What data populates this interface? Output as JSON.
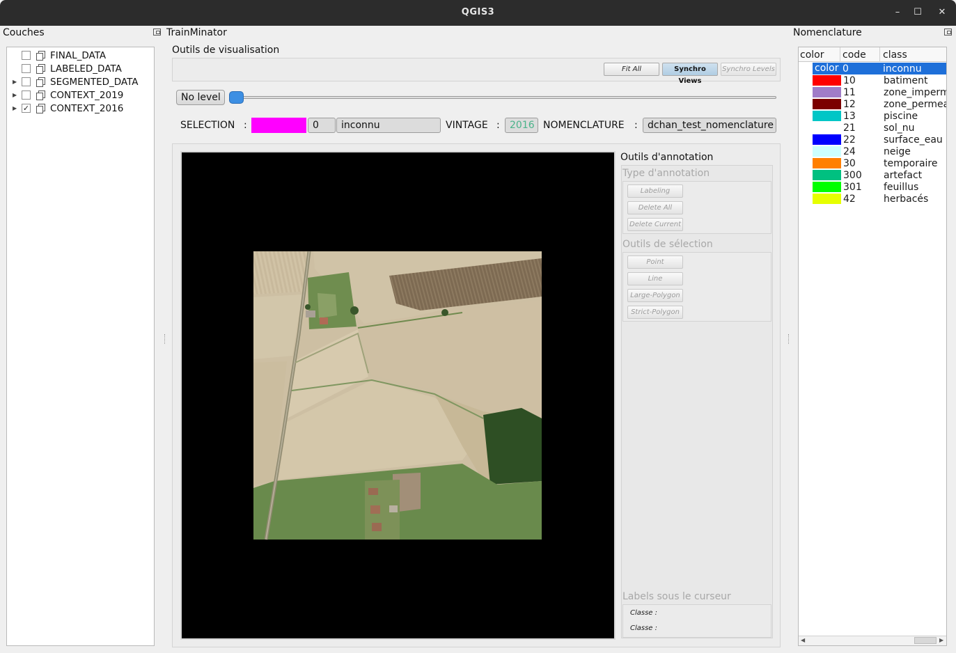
{
  "window": {
    "title": "QGIS3",
    "controls": [
      "–",
      "☐",
      "✕"
    ]
  },
  "layers_panel": {
    "title": "Couches",
    "items": [
      {
        "label": "FINAL_DATA",
        "checked": false,
        "expandable": false
      },
      {
        "label": "LABELED_DATA",
        "checked": false,
        "expandable": false
      },
      {
        "label": "SEGMENTED_DATA",
        "checked": false,
        "expandable": true
      },
      {
        "label": "CONTEXT_2019",
        "checked": false,
        "expandable": true
      },
      {
        "label": "CONTEXT_2016",
        "checked": true,
        "expandable": true
      }
    ]
  },
  "main_panel": {
    "title": "TrainMinator",
    "visualisation_title": "Outils de visualisation",
    "buttons": {
      "fit_all": "Fit All",
      "synchro_views": "Synchro Views",
      "synchro_levels": "Synchro Levels"
    },
    "level_label": "No level",
    "selection": {
      "label": "SELECTION",
      "colon": ":",
      "color": "#ff00ff",
      "code": "0",
      "class": "inconnu",
      "vintage_label": "VINTAGE",
      "vintage_value": "2016",
      "nomenclature_label": "NOMENCLATURE",
      "nomenclature_value": "dchan_test_nomenclature"
    },
    "annotation": {
      "title": "Outils d'annotation",
      "type_title": "Type d'annotation",
      "type_buttons": [
        "Labeling",
        "Delete All",
        "Delete Current"
      ],
      "selection_title": "Outils de sélection",
      "selection_buttons": [
        "Point",
        "Line",
        "Large-Polygon",
        "Strict-Polygon"
      ],
      "cursor_title": "Labels sous le curseur",
      "cursor_rows": [
        "Classe :",
        "Classe :"
      ]
    }
  },
  "nomenclature_panel": {
    "title": "Nomenclature",
    "headers": [
      "color",
      "code",
      "class"
    ],
    "rows": [
      {
        "color": "#1e6fd9",
        "color_text": "color",
        "code": "0",
        "class": "inconnu",
        "selected": true
      },
      {
        "color": "#ff0000",
        "code": "10",
        "class": "batiment"
      },
      {
        "color": "#a07cc8",
        "code": "11",
        "class": "zone_imperm"
      },
      {
        "color": "#7b0000",
        "code": "12",
        "class": "zone_permea"
      },
      {
        "color": "#00c6c6",
        "code": "13",
        "class": "piscine"
      },
      {
        "color": "#ffffff",
        "code": "21",
        "class": "sol_nu"
      },
      {
        "color": "#0000ff",
        "code": "22",
        "class": "surface_eau"
      },
      {
        "color": "#ccffff",
        "code": "24",
        "class": "neige"
      },
      {
        "color": "#ff7f00",
        "code": "30",
        "class": "temporaire"
      },
      {
        "color": "#00c080",
        "code": "300",
        "class": "artefact"
      },
      {
        "color": "#00ff00",
        "code": "301",
        "class": "feuillus"
      },
      {
        "color": "#e6ff00",
        "code": "42",
        "class": "herbacés"
      }
    ]
  }
}
